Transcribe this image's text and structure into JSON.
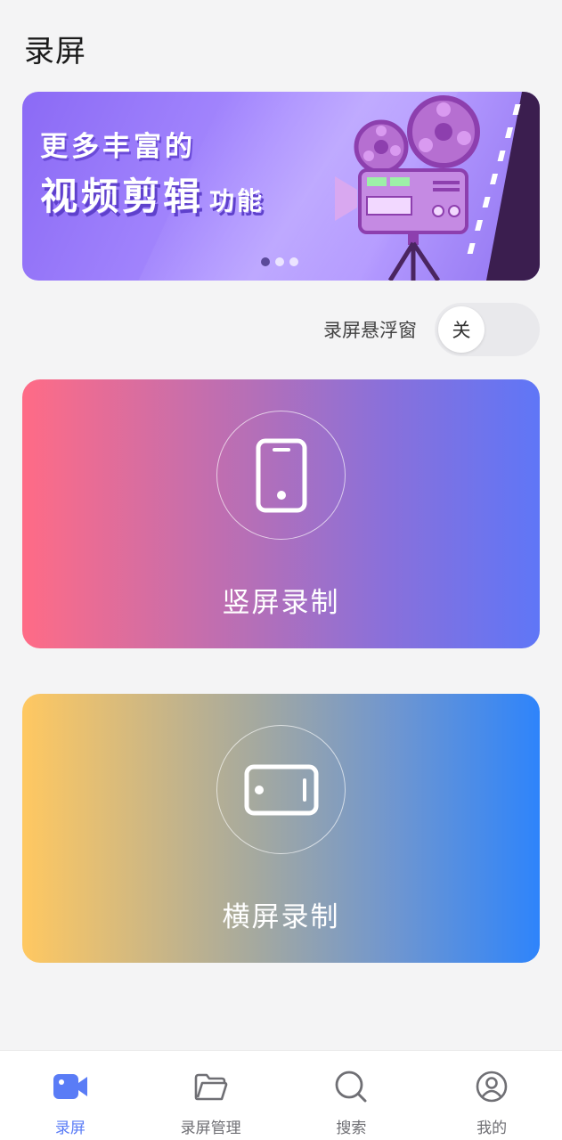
{
  "page": {
    "title": "录屏"
  },
  "banner": {
    "line1": "更多丰富的",
    "line2": "视频剪辑",
    "line2_suffix": "功能",
    "dots": 3,
    "active_dot": 0,
    "icon": "film-projector-illustration"
  },
  "float_window": {
    "label": "录屏悬浮窗",
    "state_label": "关",
    "enabled": false
  },
  "cards": {
    "portrait": {
      "label": "竖屏录制",
      "icon": "phone-portrait-icon"
    },
    "landscape": {
      "label": "横屏录制",
      "icon": "phone-landscape-icon"
    }
  },
  "nav": {
    "items": [
      {
        "label": "录屏",
        "icon": "video-camera-icon",
        "active": true
      },
      {
        "label": "录屏管理",
        "icon": "folder-icon",
        "active": false
      },
      {
        "label": "搜索",
        "icon": "search-icon",
        "active": false
      },
      {
        "label": "我的",
        "icon": "user-icon",
        "active": false
      }
    ]
  },
  "colors": {
    "accent": "#5a7cf6",
    "portrait_gradient": [
      "#ff6b86",
      "#5f76f7"
    ],
    "landscape_gradient": [
      "#ffc861",
      "#2e84fb"
    ],
    "banner": "#9b7cf9"
  }
}
